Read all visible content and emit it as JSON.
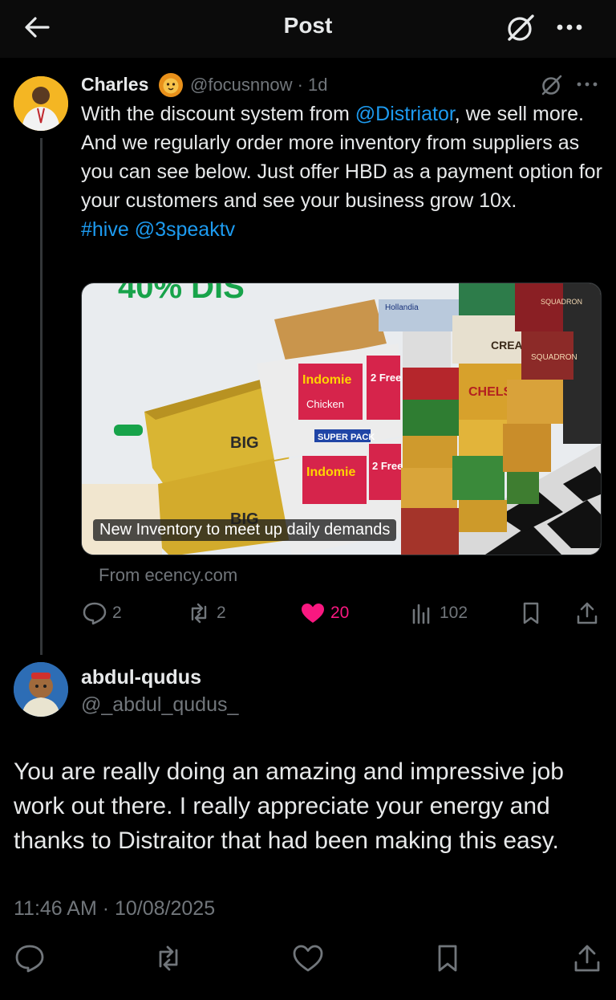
{
  "header": {
    "title": "Post",
    "icons": [
      "back-arrow-icon",
      "grok-icon",
      "more-icon"
    ]
  },
  "post": {
    "author_name": "Charles",
    "author_emoji": "lion-face",
    "handle_time": "@focusnnow · 1d",
    "text_parts": {
      "p1": "With the discount system from ",
      "mention1": "@Distriator",
      "p2": ", we sell more. And we regularly order more inventory from suppliers as you can see below. Just offer HBD as a payment option for your customers and see your business grow 10x.",
      "hashtag": "#hive",
      "mention2": "@3speaktv"
    },
    "media": {
      "caption": "New Inventory to meet up daily demands",
      "banner_text": "40% DIS",
      "carton_labels": [
        "Indomie",
        "2 Free",
        "Chicken",
        "SUPER PACK",
        "CHELSEA",
        "SQUADRON",
        "CREAM",
        "Hollandia",
        "BIG"
      ]
    },
    "source": "From ecency.com",
    "stats": {
      "replies": "2",
      "reposts": "2",
      "likes": "20",
      "views": "102"
    },
    "colors": {
      "link": "#1d9bf0",
      "like": "#f91880",
      "muted": "#71767b"
    }
  },
  "reply": {
    "author_name": "abdul-qudus",
    "handle": "@_abdul_qudus_",
    "text": "You are really doing an amazing and impressive job work out there. I really appreciate your energy and thanks to Distraitor that had been making this easy.",
    "timestamp": "11:46 AM · 10/08/2025"
  }
}
